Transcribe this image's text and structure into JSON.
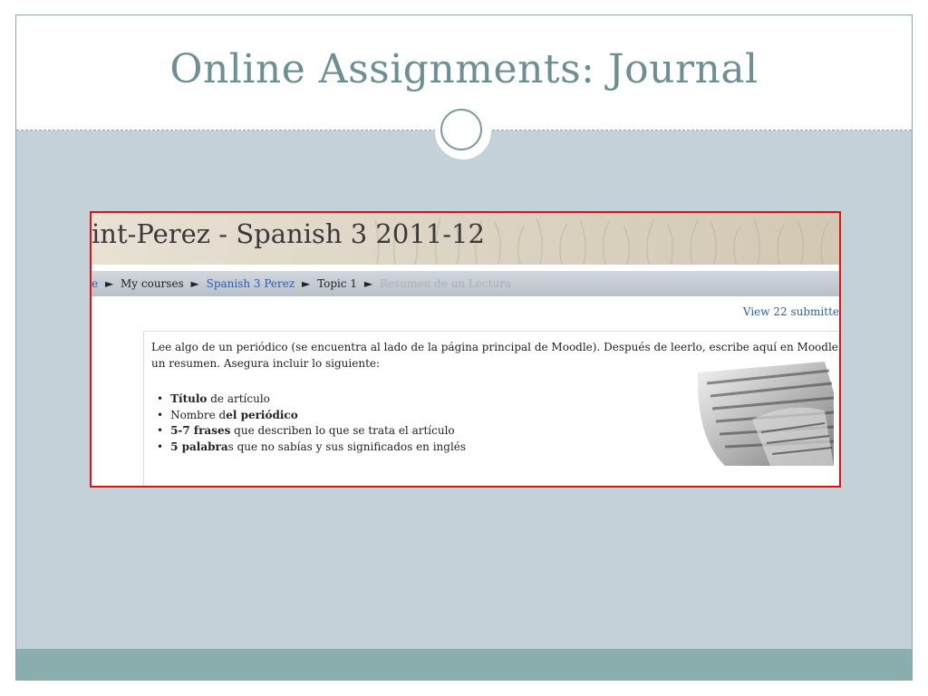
{
  "slide": {
    "title": "Online Assignments:  Journal"
  },
  "screenshot": {
    "site_title": "int-Perez - Spanish 3 2011-12",
    "breadcrumb": {
      "home_fragment": "e",
      "separator": "►",
      "my_courses": "My courses",
      "course": "Spanish 3 Perez",
      "topic": "Topic 1",
      "assignment": "Resumen de un Lectura"
    },
    "view_link": "View 22 submitte",
    "intro": {
      "text": "Lee algo de un periódico (se encuentra al lado de la página principal de Moodle).  Después de leerlo, escribe aquí en Moodle un resumen.  Asegura incluir lo siguiente:",
      "items": [
        {
          "bold": "Título",
          "rest_after": " de artículo"
        },
        {
          "lead": "Nombre d",
          "bold": "el periódico"
        },
        {
          "bold": "5-7 frases",
          "rest_after": " que describen lo que se trata el artículo"
        },
        {
          "bold": "5 palabra",
          "rest_after": "s que no sabías y sus significados en inglés"
        }
      ]
    }
  },
  "colors": {
    "title": "#6b8f94",
    "content_bg": "#c5d1d8",
    "footer_bar": "#8aadae",
    "highlight_border": "#e01010",
    "link": "#2a5db0"
  }
}
